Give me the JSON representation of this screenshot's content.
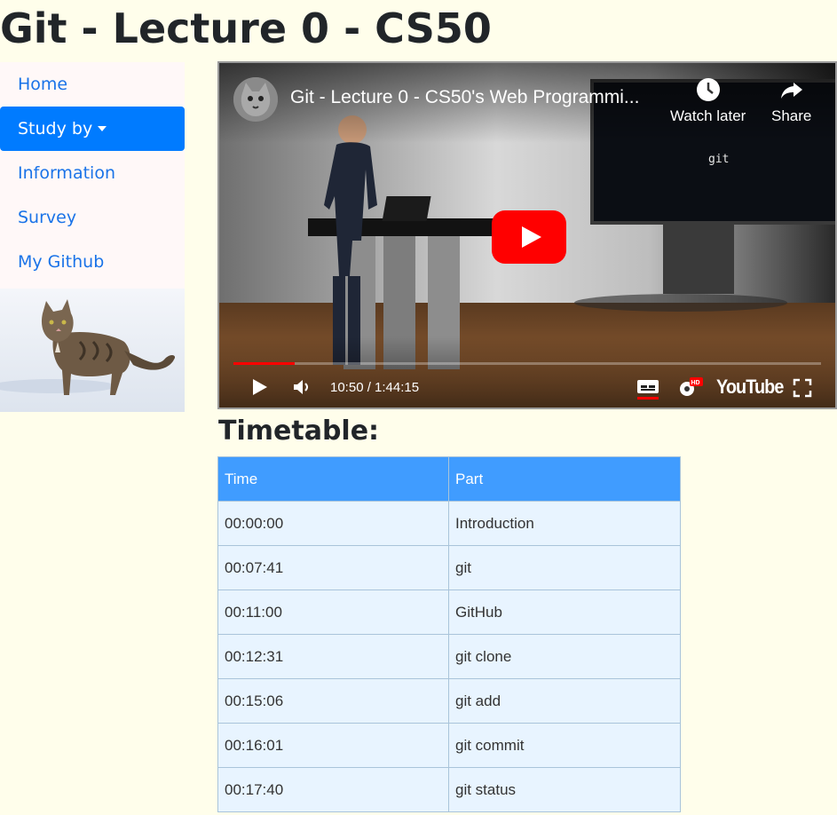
{
  "page": {
    "title": "Git - Lecture 0 - CS50"
  },
  "sidebar": {
    "items": [
      {
        "label": "Home",
        "active": false
      },
      {
        "label": "Study by",
        "active": true,
        "dropdown": true
      },
      {
        "label": "Information",
        "active": false
      },
      {
        "label": "Survey",
        "active": false
      },
      {
        "label": "My Github",
        "active": false
      }
    ],
    "image": "cat photo in snow"
  },
  "video": {
    "title": "Git - Lecture 0 - CS50's Web Programmi...",
    "watch_later_label": "Watch later",
    "share_label": "Share",
    "time": "10:50 / 1:44:15",
    "screen_text": "git",
    "progress": 0.104,
    "logo_text": "YouTube",
    "hd_badge": "HD"
  },
  "timetable": {
    "heading": "Timetable:",
    "columns": [
      "Time",
      "Part"
    ],
    "rows": [
      [
        "00:00:00",
        "Introduction"
      ],
      [
        "00:07:41",
        "git"
      ],
      [
        "00:11:00",
        "GitHub"
      ],
      [
        "00:12:31",
        "git clone"
      ],
      [
        "00:15:06",
        "git add"
      ],
      [
        "00:16:01",
        "git commit"
      ],
      [
        "00:17:40",
        "git status"
      ]
    ]
  },
  "colors": {
    "background": "#fffeeb",
    "accent": "#007bff",
    "table_header": "#409cff",
    "table_cell": "#e8f4ff",
    "youtube_red": "#ff0000"
  }
}
